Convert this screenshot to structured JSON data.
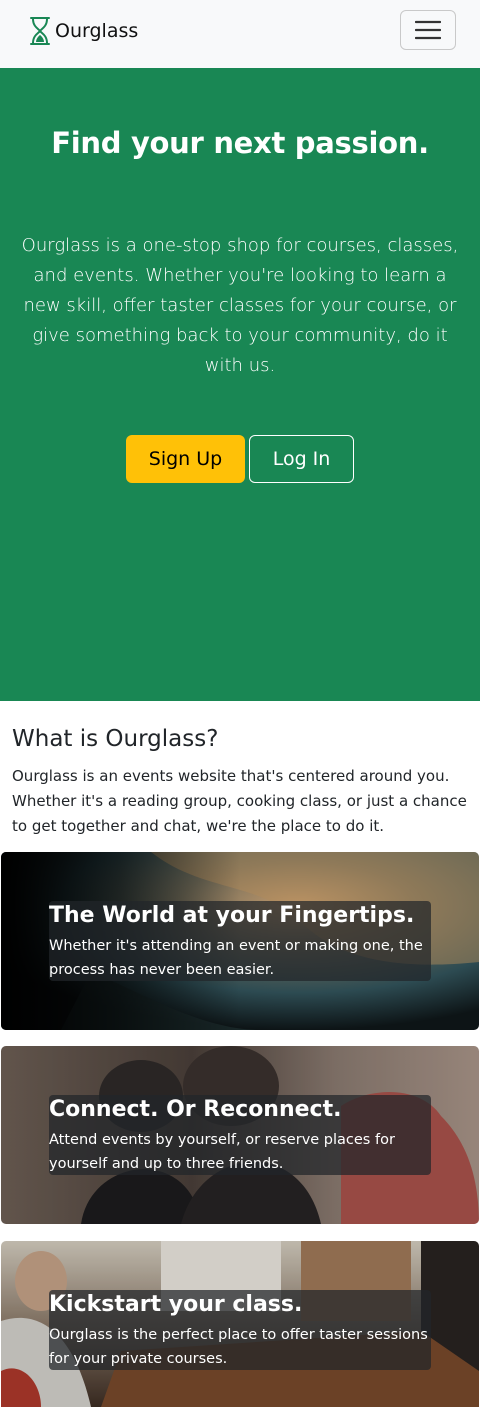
{
  "navbar": {
    "brand": "Ourglass",
    "brand_icon": "hourglass-icon",
    "menu_icon": "hamburger-menu-icon"
  },
  "hero": {
    "title": "Find your next passion.",
    "text": "Ourglass is a one-stop shop for courses, classes, and events. Whether you're looking to learn a new skill, offer taster classes for your course, or give something back to your community, do it with us.",
    "signup_label": "Sign Up",
    "login_label": "Log In",
    "bg_color": "#198754",
    "signup_color": "#ffc107"
  },
  "about": {
    "title": "What is Ourglass?",
    "text": "Ourglass is an events website that's centered around you. Whether it's a reading group, cooking class, or just a chance to get together and chat, we're the place to do it."
  },
  "cards": [
    {
      "title": "The World at your Fingertips.",
      "text": "Whether it's attending an event or making one, the process has never been easier."
    },
    {
      "title": "Connect. Or Reconnect.",
      "text": "Attend events by yourself, or reserve places for yourself and up to three friends."
    },
    {
      "title": "Kickstart your class.",
      "text": "Ourglass is the perfect place to offer taster sessions for your private courses."
    }
  ]
}
